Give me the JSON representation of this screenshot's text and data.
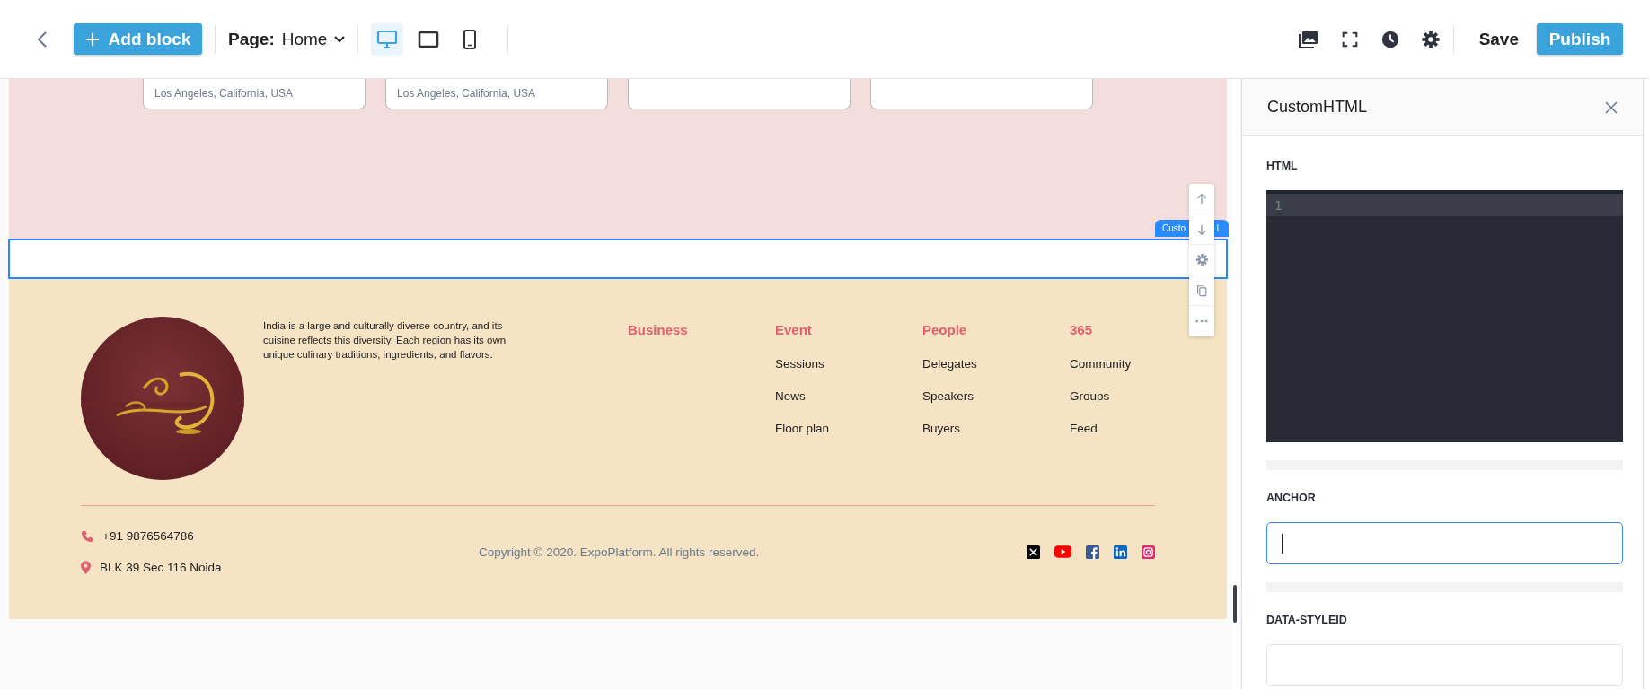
{
  "toolbar": {
    "add_block": "Add block",
    "page_label": "Page:",
    "page": "Home",
    "devices": [
      {
        "kind": "desktop",
        "selected": true
      },
      {
        "kind": "tablet",
        "selected": false
      },
      {
        "kind": "phone",
        "selected": false
      }
    ],
    "save": "Save",
    "publish": "Publish"
  },
  "cards": [
    {
      "kind": "text",
      "location": "Los Angeles, California, USA"
    },
    {
      "kind": "text",
      "location": "Los Angeles, California, USA"
    },
    {
      "kind": "blank"
    },
    {
      "kind": "blank"
    }
  ],
  "selected_block": {
    "label_visible": [
      "Custo",
      "L"
    ]
  },
  "footer": {
    "description": "India is a large and culturally diverse country, and its cuisine reflects this diversity. Each region has its own unique culinary traditions, ingredients, and flavors.",
    "columns": [
      {
        "heading": "Business"
      },
      {
        "heading": "Event",
        "links": [
          "Sessions",
          "News",
          "Floor plan"
        ]
      },
      {
        "heading": "People",
        "links": [
          "Delegates",
          "Speakers",
          "Buyers"
        ]
      },
      {
        "heading": "365",
        "links": [
          "Community",
          "Groups",
          "Feed"
        ]
      }
    ],
    "phone": "+91 9876564786",
    "address": "BLK 39 Sec 116 Noida",
    "copyright": "Copyright © 2020. ExpoPlatform. All rights reserved.",
    "socials": [
      {
        "kind": "x"
      },
      {
        "kind": "youtube"
      },
      {
        "kind": "facebook"
      },
      {
        "kind": "linkedin"
      },
      {
        "kind": "instagram"
      }
    ]
  },
  "panel": {
    "title": "CustomHTML",
    "fields": [
      {
        "kind": "code",
        "label": "HTML",
        "line_numbers": [
          "1"
        ]
      },
      {
        "kind": "text",
        "label": "ANCHOR",
        "focused": true
      },
      {
        "kind": "text",
        "label": "DATA-STYLEID",
        "focused": false
      }
    ]
  }
}
